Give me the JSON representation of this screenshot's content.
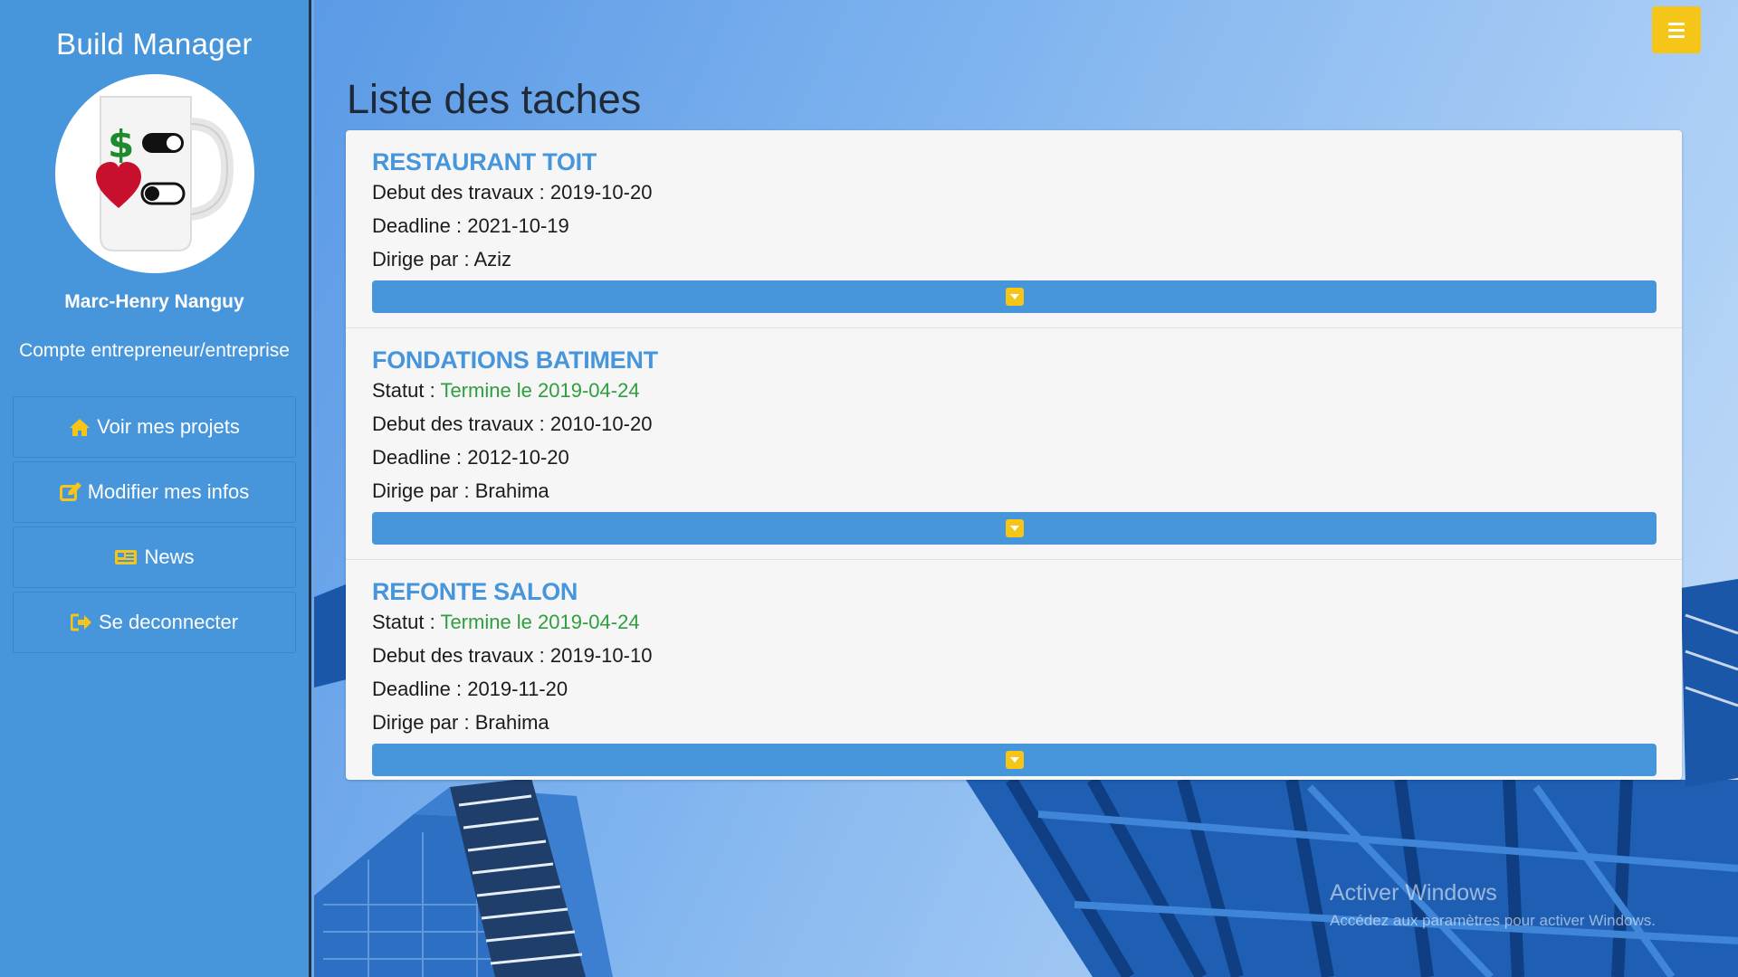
{
  "app": {
    "title": "Build Manager"
  },
  "user": {
    "name": "Marc-Henry Nanguy",
    "account_type": "Compte entrepreneur/entreprise",
    "avatar_icon": "mug-icon"
  },
  "menu": {
    "items": [
      {
        "label": "Voir mes projets",
        "icon": "home-icon"
      },
      {
        "label": "Modifier mes infos",
        "icon": "edit-icon"
      },
      {
        "label": "News",
        "icon": "newspaper-icon"
      },
      {
        "label": "Se deconnecter",
        "icon": "sign-out-icon"
      }
    ]
  },
  "page": {
    "title": "Liste des taches"
  },
  "labels": {
    "status": "Statut :",
    "start": "Debut des travaux :",
    "deadline": "Deadline :",
    "lead": "Dirige par :"
  },
  "tasks": [
    {
      "name": "RESTAURANT TOIT",
      "start": "2019-10-20",
      "deadline": "2021-10-19",
      "lead": "Aziz"
    },
    {
      "name": "FONDATIONS BATIMENT",
      "status": "Termine le 2019-04-24",
      "start": "2010-10-20",
      "deadline": "2012-10-20",
      "lead": "Brahima"
    },
    {
      "name": "REFONTE SALON",
      "status": "Termine le 2019-04-24",
      "start": "2019-10-10",
      "deadline": "2019-11-20",
      "lead": "Brahima"
    }
  ],
  "watermark": {
    "title": "Activer Windows",
    "subtitle": "Accédez aux paramètres pour activer Windows."
  },
  "colors": {
    "sidebar": "#4796dc",
    "accent": "#f5c518",
    "done": "#2e9e3e",
    "title_blue": "#4796dc"
  }
}
